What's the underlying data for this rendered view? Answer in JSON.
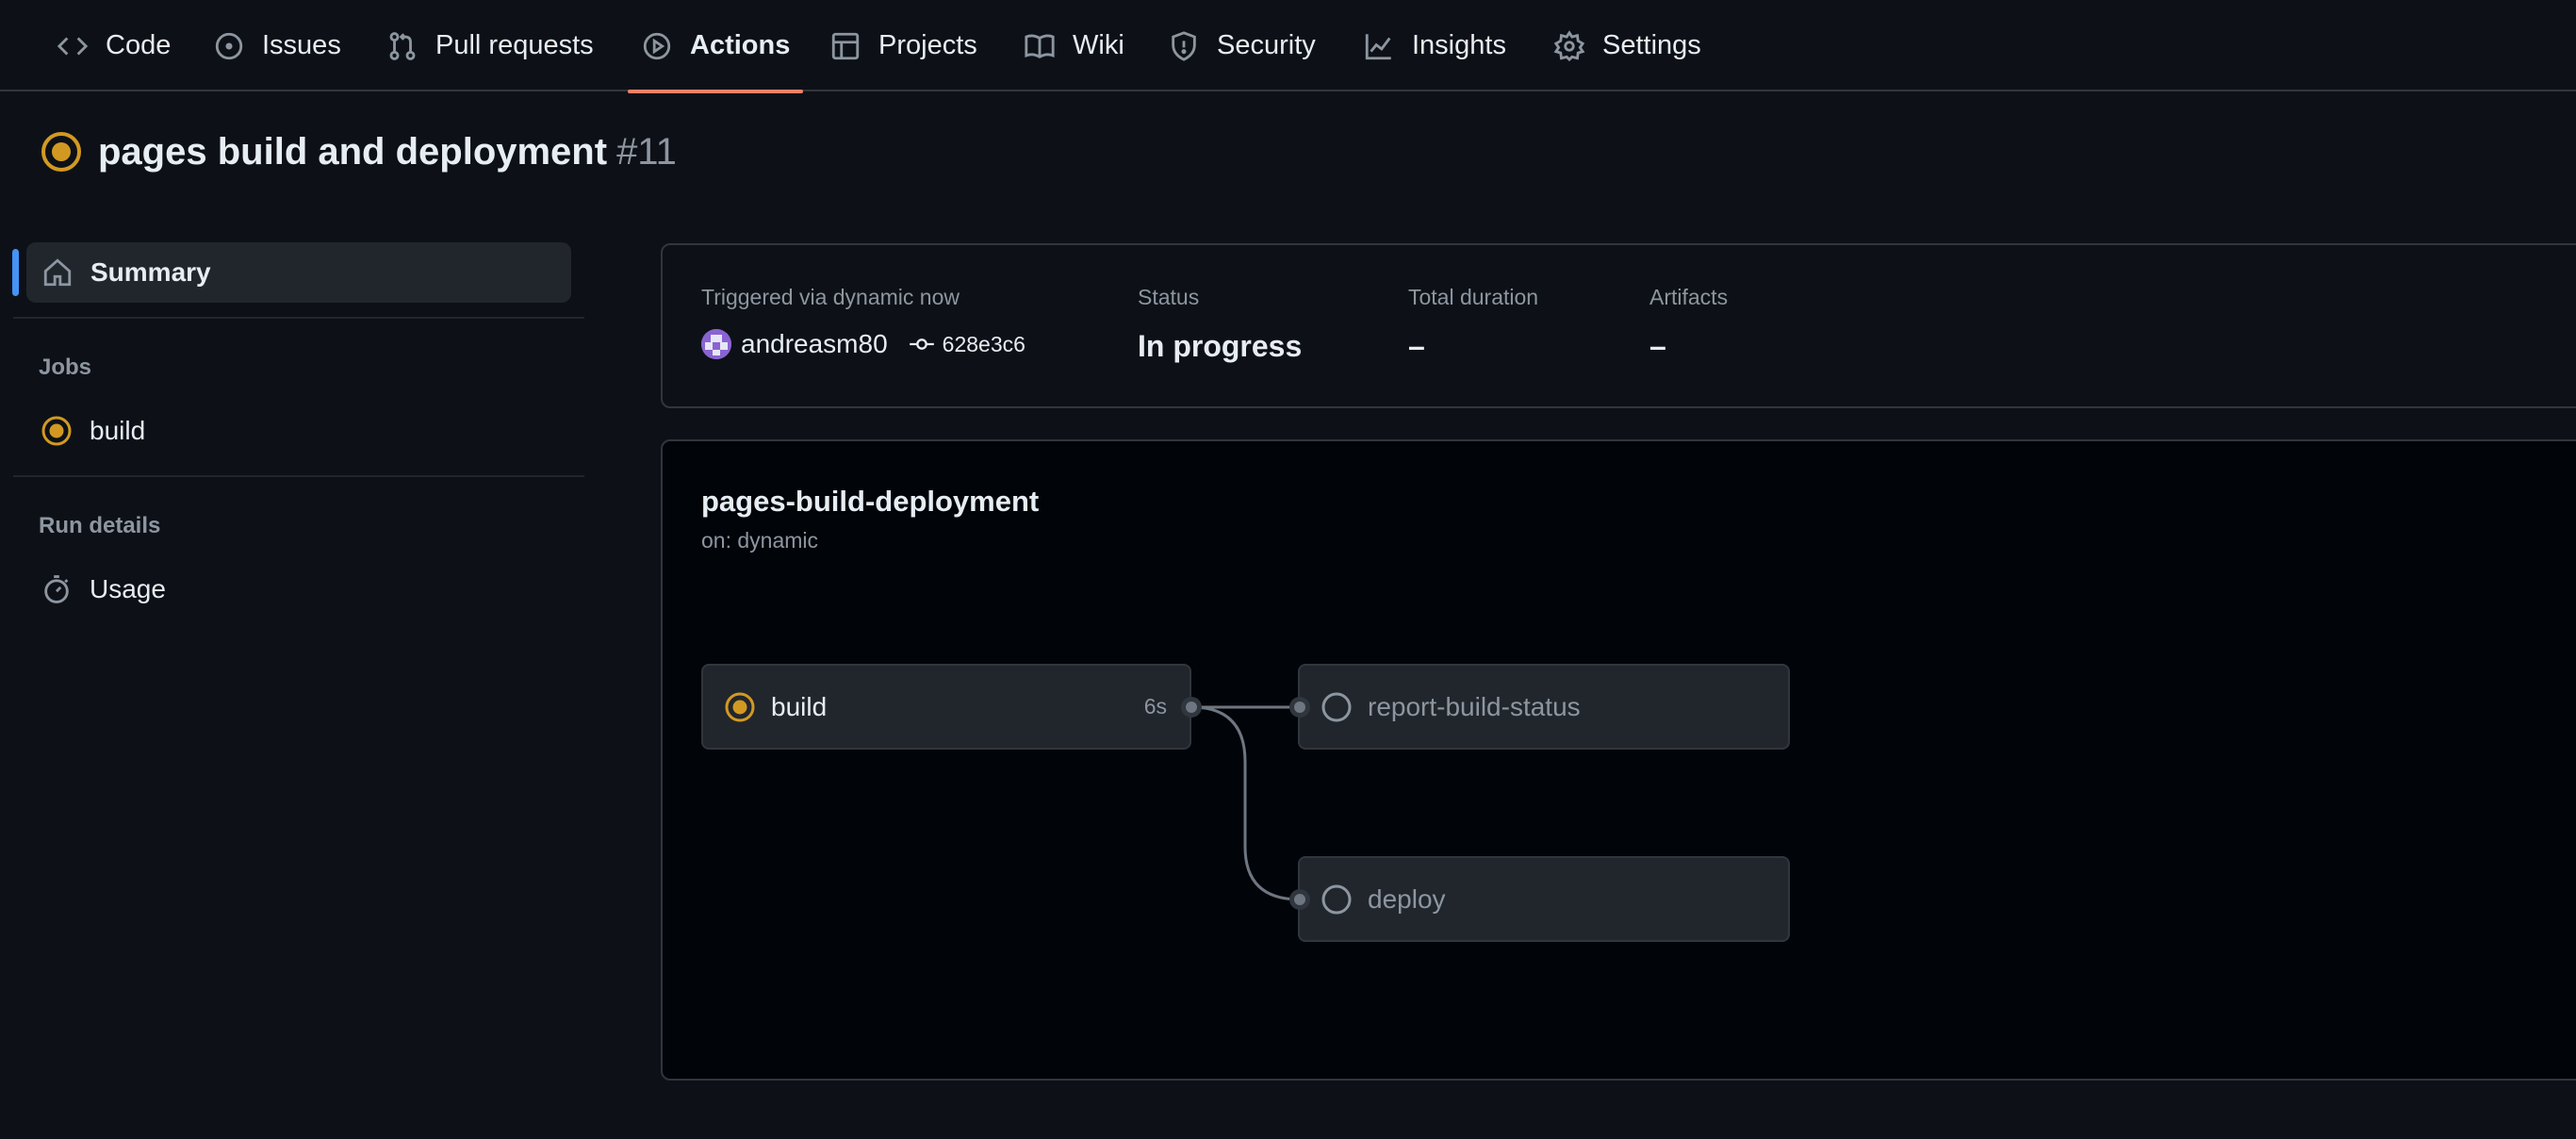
{
  "nav": {
    "tabs": [
      {
        "label": "Code",
        "icon": "code-icon"
      },
      {
        "label": "Issues",
        "icon": "issue-icon"
      },
      {
        "label": "Pull requests",
        "icon": "pull-request-icon"
      },
      {
        "label": "Actions",
        "icon": "play-icon",
        "active": true
      },
      {
        "label": "Projects",
        "icon": "table-icon"
      },
      {
        "label": "Wiki",
        "icon": "book-icon"
      },
      {
        "label": "Security",
        "icon": "shield-icon"
      },
      {
        "label": "Insights",
        "icon": "graph-icon"
      },
      {
        "label": "Settings",
        "icon": "gear-icon"
      }
    ]
  },
  "run": {
    "title": "pages build and deployment",
    "number": "#11",
    "status_icon": "in-progress-icon"
  },
  "sidebar": {
    "summary_label": "Summary",
    "jobs_heading": "Jobs",
    "jobs": [
      {
        "label": "build",
        "status": "in_progress"
      }
    ],
    "run_details_heading": "Run details",
    "usage_label": "Usage"
  },
  "info": {
    "trigger_label": "Triggered via dynamic now",
    "user": "andreasm80",
    "commit": "628e3c6",
    "status_label": "Status",
    "status_value": "In progress",
    "duration_label": "Total duration",
    "duration_value": "–",
    "artifacts_label": "Artifacts",
    "artifacts_value": "–"
  },
  "workflow": {
    "name": "pages-build-deployment",
    "trigger": "on: dynamic",
    "jobs": {
      "build": {
        "label": "build",
        "duration": "6s",
        "status": "in_progress"
      },
      "report": {
        "label": "report-build-status",
        "status": "pending"
      },
      "deploy": {
        "label": "deploy",
        "status": "pending"
      }
    }
  },
  "colors": {
    "background": "#0d1117",
    "graph_background": "#010409",
    "accent_tab": "#f78166",
    "in_progress": "#d29922",
    "active_indicator": "#4493f8"
  }
}
